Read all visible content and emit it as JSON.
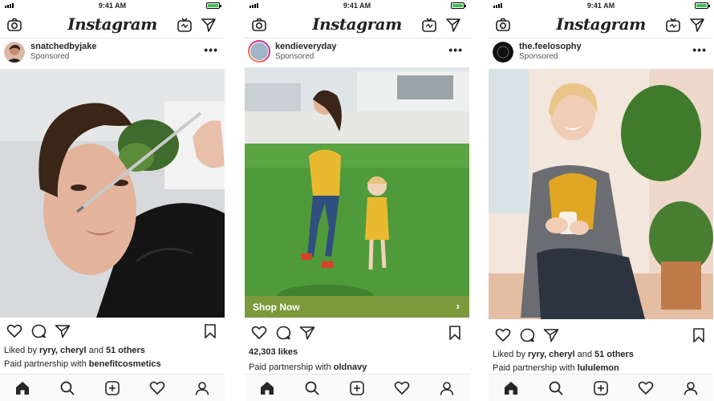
{
  "status": {
    "time": "9:41 AM"
  },
  "app": {
    "logo": "Instagram"
  },
  "icons": {
    "camera": "camera-icon",
    "igtv": "igtv-icon",
    "direct": "paper-plane-icon",
    "more": "more-icon",
    "like": "heart-icon",
    "comment": "comment-icon",
    "share": "share-icon",
    "save": "bookmark-icon",
    "home": "home-icon",
    "search": "search-icon",
    "add": "plus-square-icon",
    "activity": "heart-icon",
    "profile": "profile-icon"
  },
  "colors": {
    "cta_green": "#7c9a3c",
    "battery_green": "#3dc150",
    "text": "#262626"
  },
  "posts": [
    {
      "username": "snatchedbyjake",
      "sponsored": "Sponsored",
      "more": "•••",
      "likes_prefix": "Liked by ",
      "likes_names": "ryry, cheryl",
      "likes_mid": " and ",
      "likes_count": "51 others",
      "partner_prefix": "Paid partnership with ",
      "partner_brand": "benefitcosmetics"
    },
    {
      "username": "kendieveryday",
      "sponsored": "Sponsored",
      "more": "•••",
      "cta": "Shop Now",
      "cta_arrow": "›",
      "likes": "42,303 likes",
      "partner_prefix": "Paid partnership with ",
      "partner_brand": "oldnavy"
    },
    {
      "username": "the.feelosophy",
      "sponsored": "Sponsored",
      "more": "•••",
      "likes_prefix": "Liked by ",
      "likes_names": "ryry, cheryl",
      "likes_mid": " and ",
      "likes_count": "51 others",
      "partner_prefix": "Paid partnership with ",
      "partner_brand": "lululemon"
    }
  ]
}
